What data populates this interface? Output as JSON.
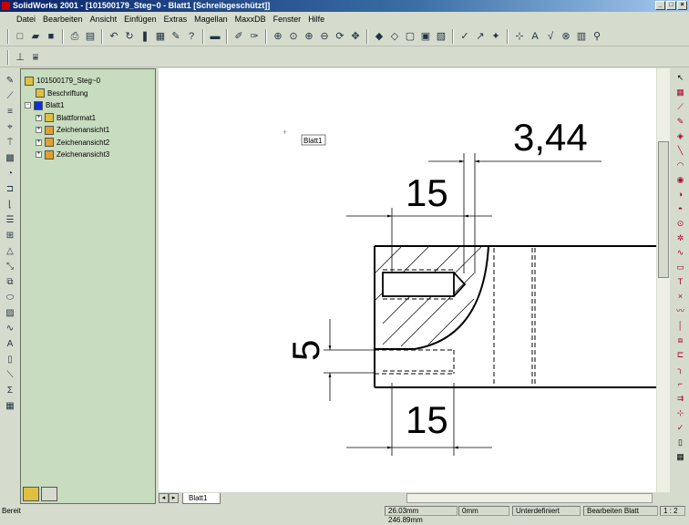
{
  "window": {
    "title": "SolidWorks 2001 - [101500179_Steg~0 - Blatt1 [Schreibgeschützt]]",
    "controls": [
      "_",
      "□",
      "×"
    ]
  },
  "menu": [
    "Datei",
    "Bearbeiten",
    "Ansicht",
    "Einfügen",
    "Extras",
    "Magellan",
    "MaxxDB",
    "Fenster",
    "Hilfe"
  ],
  "tree": {
    "root": "101500179_Steg~0",
    "items": [
      {
        "label": "Beschriftung",
        "color": "#e0c040"
      },
      {
        "label": "Blatt1",
        "color": "#1030d0"
      },
      {
        "label": "Blattformat1",
        "color": "#e0c040"
      },
      {
        "label": "Zeichenansicht1",
        "color": "#e0a030"
      },
      {
        "label": "Zeichenansicht2",
        "color": "#e0a030"
      },
      {
        "label": "Zeichenansicht3",
        "color": "#e0a030"
      }
    ]
  },
  "drawing": {
    "sheet_label": "Blatt1",
    "dim_top_right": "3,44",
    "dim_top": "15",
    "dim_left": "5",
    "dim_bottom": "15"
  },
  "sheet_tab": "Blatt1",
  "status": {
    "left": "Bereit",
    "coords": "26.03mm 246.89mm",
    "z": "0mm",
    "state": "Unterdefiniert",
    "mode": "Bearbeiten Blatt",
    "scale": "1 : 2"
  },
  "colors": {
    "title": "#0a246a",
    "panel": "#c8dcc0"
  }
}
